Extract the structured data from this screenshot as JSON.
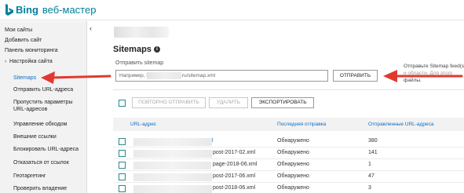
{
  "header": {
    "brand": "Bing",
    "product": "веб-мастер",
    "brand_color": "#00809d"
  },
  "sidebar": {
    "items": [
      {
        "label": "Мои сайты",
        "state": "normal"
      },
      {
        "label": "Добавить сайт",
        "state": "normal"
      },
      {
        "label": "Панель мониторинга",
        "state": "normal"
      },
      {
        "label": "Настройка сайта",
        "state": "expanded-parent"
      },
      {
        "label": "Sitemaps",
        "state": "active"
      },
      {
        "label": "Отправить URL-адреса",
        "state": "normal"
      },
      {
        "label": "Пропустить параметры",
        "state": "normal"
      },
      {
        "label": "URL-адресов",
        "state": "normal"
      },
      {
        "label": "Управление обходом",
        "state": "normal"
      },
      {
        "label": "Внешние ссылки",
        "state": "normal"
      },
      {
        "label": "Блокировать URL-адреса",
        "state": "normal"
      },
      {
        "label": "Отказаться от ссылок",
        "state": "normal"
      },
      {
        "label": "Геотаргетинг",
        "state": "normal"
      },
      {
        "label": "Проверить владение",
        "state": "normal"
      }
    ],
    "collapse_icon": "chevron-left-icon",
    "active_color": "#0c6dc4"
  },
  "main": {
    "title": "Sitemaps",
    "info_glyph": "i",
    "submit": {
      "label": "Отправить sitemap",
      "input_prefix": "Например, h",
      "input_suffix": ".ru/sitemap.xml",
      "button": "ОТПРАВИТЬ",
      "help_line1": "Отправьте Sitemap feed(s",
      "help_line2": "и области. Для этого",
      "help_line3": "файлы."
    },
    "toolbar": {
      "resubmit": "ПОВТОРНО ОТПРАВИТЬ",
      "delete": "УДАЛИТЬ",
      "export": "ЭКСПОРТИРОВАТЬ"
    },
    "table": {
      "columns": [
        "URL-адрес",
        "Последняя отправка",
        "Отправленные URL-адреса"
      ],
      "rows": [
        {
          "url": "l",
          "status": "Обнаружено",
          "count": "380"
        },
        {
          "url": "post-2017-02.xml",
          "status": "Обнаружено",
          "count": "141"
        },
        {
          "url": "page-2018-06.xml",
          "status": "Обнаружено",
          "count": "1"
        },
        {
          "url": "post-2017-06.xml",
          "status": "Обнаружено",
          "count": "47"
        },
        {
          "url": "post-2018-06.xml",
          "status": "Обнаружено",
          "count": "3"
        }
      ]
    }
  },
  "annotations": {
    "arrow_color": "#e03a2f"
  }
}
